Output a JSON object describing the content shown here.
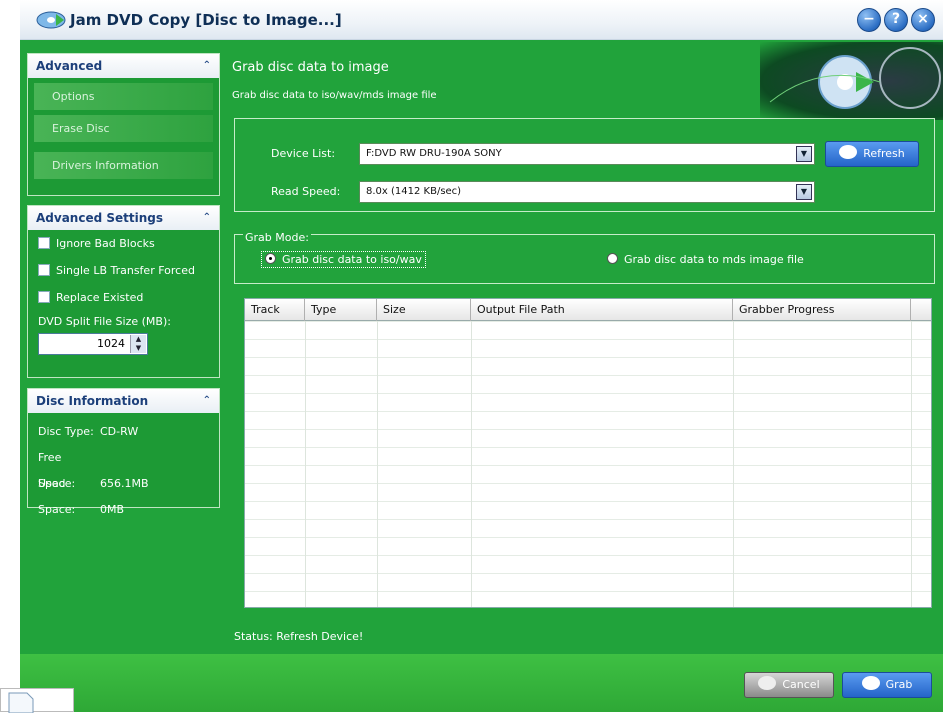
{
  "window": {
    "title": "Jam DVD Copy [Disc to Image...]"
  },
  "advanced_panel": {
    "header": "Advanced",
    "items": [
      {
        "label": "Options"
      },
      {
        "label": "Erase Disc"
      },
      {
        "label": "Drivers Information"
      }
    ]
  },
  "advanced_settings": {
    "header": "Advanced Settings",
    "options": [
      {
        "label": "Ignore Bad Blocks"
      },
      {
        "label": "Single LB Transfer Forced"
      },
      {
        "label": "Replace Existed"
      }
    ],
    "split_label": "DVD Split File Size (MB):",
    "split_value": "1024"
  },
  "disc_info": {
    "header": "Disc Information",
    "rows": [
      {
        "label": "Disc Type:",
        "value": "CD-RW"
      },
      {
        "label": "Free Space:",
        "value": "656.1MB"
      },
      {
        "label": "Used Space:",
        "value": "0MB"
      }
    ]
  },
  "main": {
    "title": "Grab disc data to image",
    "subtitle": "Grab disc data to iso/wav/mds image file",
    "device_list_label": "Device List:",
    "device_list_value": "F:DVD RW DRU-190A SONY",
    "refresh_label": "Refresh",
    "read_speed_label": "Read Speed:",
    "read_speed_value": "8.0x (1412 KB/sec)",
    "grab_mode_label": "Grab Mode:",
    "grab_mode_options": [
      {
        "label": "Grab disc data to iso/wav",
        "selected": true
      },
      {
        "label": "Grab disc data to mds image file",
        "selected": false
      }
    ],
    "table_columns": [
      "Track",
      "Type",
      "Size",
      "Output File Path",
      "Grabber Progress"
    ],
    "status": "Status: Refresh Device!"
  },
  "footer": {
    "cancel_label": "Cancel",
    "grab_label": "Grab"
  },
  "colors": {
    "panel_green": "#21a33b",
    "header_text": "#1c3f7a",
    "button_blue": "#2464c8"
  }
}
